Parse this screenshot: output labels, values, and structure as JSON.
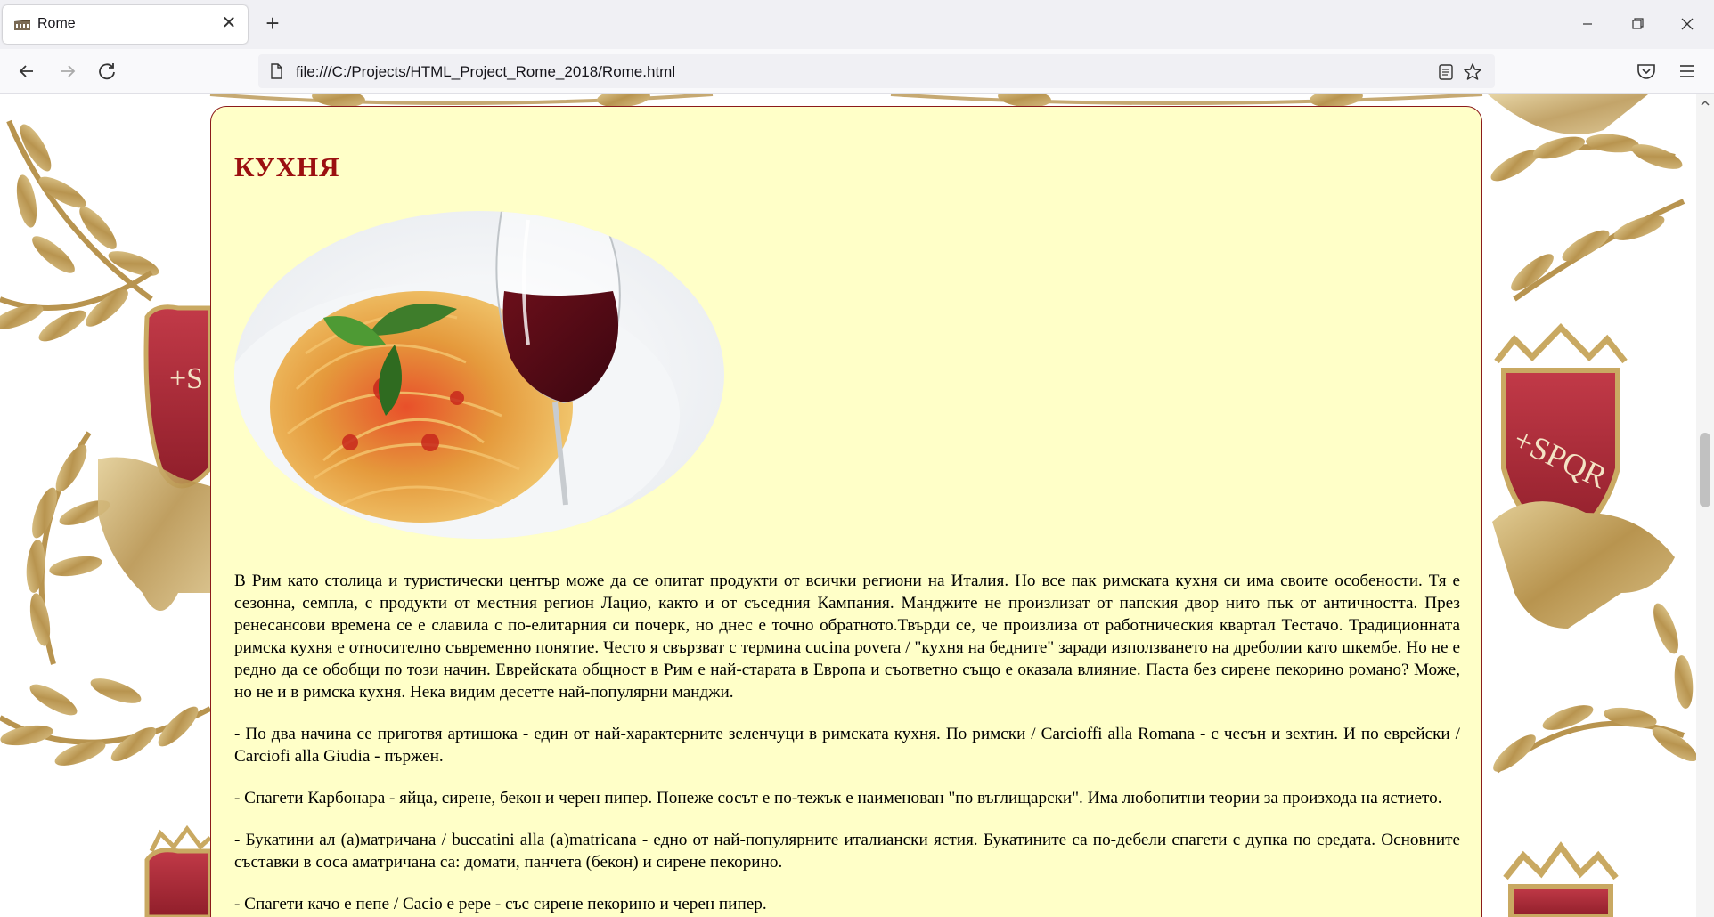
{
  "browser": {
    "tab_title": "Rome",
    "url": "file:///C:/Projects/HTML_Project_Rome_2018/Rome.html"
  },
  "icons": {
    "favicon": "colosseum-icon",
    "close": "close-icon",
    "new_tab": "plus-icon",
    "back": "back-arrow-icon",
    "forward": "forward-arrow-icon",
    "reload": "reload-icon",
    "reader": "reader-view-icon",
    "bookmark": "star-icon",
    "pocket": "pocket-icon",
    "menu": "hamburger-menu-icon"
  },
  "colors": {
    "panel_background": "#ffffc8",
    "heading": "#9b1010",
    "panel_border": "#8b1a1a"
  },
  "page": {
    "heading": "КУХНЯ",
    "paragraphs": [
      "В Рим като столица и туристически център може да се опитат продукти от всички региони на Италия. Но все пак римската кухня си има своите особености. Тя е сезонна, семпла, с продукти от местния регион Лацио, както и от съседния Кампания. Манджите не произлизат от папския двор нито пък от античността. През ренесансови времена се е славила с по-елитарния си почерк, но днес е точно обратното.Твърди се, че произлиза от работническия квартал Тестачо. Традиционната римска кухня е относително съвременно понятие. Често я свързват с термина cucina povera / \"кухня на бедните\" заради използването на дреболии като шкембе. Но не е редно да се обобщи по този начин. Еврейската общност в Рим е най-старата в Европа и съответно също е оказала влияние. Паста без сирене пекорино романо? Може, но не и в римска кухня. Нека видим десетте най-популярни манджи.",
      "- По два начина се приготвя артишока - един от най-характерните зеленчуци в римската кухня. По римски / Carcioffi alla Romana - с чесън и зехтин. И по еврейски / Carciofi alla Giudia - пържен.",
      "- Спагети Карбонара - яйца, сирене, бекон и черен пипер. Понеже сосът е по-тежък е наименован \"по въглищарски\". Има любопитни теории за произхода на ястието.",
      "- Букатини ал (а)матричана / buccatini alla (a)matricana - едно от най-популярните италиански ястия. Букатините са по-дебели спагети с дупка по средата. Основните съставки в соса аматричана са: домати, панчета (бекон) и сирене пекорино.",
      "- Спагети качо е пепе / Cacio e pepe - със сирене пекорино и черен пипер."
    ]
  }
}
